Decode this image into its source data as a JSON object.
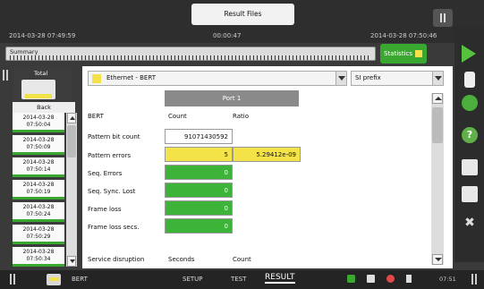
{
  "header": {
    "result_files_label": "Result Files",
    "start_time": "2014-03-28 07:49:59",
    "elapsed_time": "00:00:47",
    "current_time": "2014-03-28 07:50:46"
  },
  "summary": {
    "label": "Summary"
  },
  "statistics": {
    "label": "Statistics"
  },
  "left_panel": {
    "total_label": "Total",
    "back_label": "Back",
    "time_items": [
      {
        "date": "2014-03-28",
        "time": "07:50:04"
      },
      {
        "date": "2014-03-28",
        "time": "07:50:09"
      },
      {
        "date": "2014-03-28",
        "time": "07:50:14"
      },
      {
        "date": "2014-03-28",
        "time": "07:50:19"
      },
      {
        "date": "2014-03-28",
        "time": "07:50:24"
      },
      {
        "date": "2014-03-28",
        "time": "07:50:29"
      },
      {
        "date": "2014-03-28",
        "time": "07:50:34"
      }
    ]
  },
  "main": {
    "test_select": "Ethernet - BERT",
    "prefix_select": "SI prefix",
    "port_header": "Port 1",
    "section_label": "BERT",
    "col_count": "Count",
    "col_ratio": "Ratio",
    "rows": [
      {
        "label": "Pattern bit count",
        "count": "91071430592",
        "ratio": ""
      },
      {
        "label": "Pattern errors",
        "count": "5",
        "ratio": "5.29412e-09"
      },
      {
        "label": "Seq. Errors",
        "count": "0",
        "ratio": ""
      },
      {
        "label": "Seq. Sync. Lost",
        "count": "0",
        "ratio": ""
      },
      {
        "label": "Frame loss",
        "count": "0",
        "ratio": ""
      },
      {
        "label": "Frame loss secs.",
        "count": "0",
        "ratio": ""
      }
    ],
    "service_label": "Service disruption",
    "service_col_seconds": "Seconds",
    "service_col_count": "Count"
  },
  "bottom_bar": {
    "test_name": "BERT",
    "tabs": [
      "SETUP",
      "TEST",
      "RESULT"
    ],
    "clock": "07:51"
  },
  "colors": {
    "accent_green": "#3db339",
    "accent_yellow": "#f4e249"
  }
}
